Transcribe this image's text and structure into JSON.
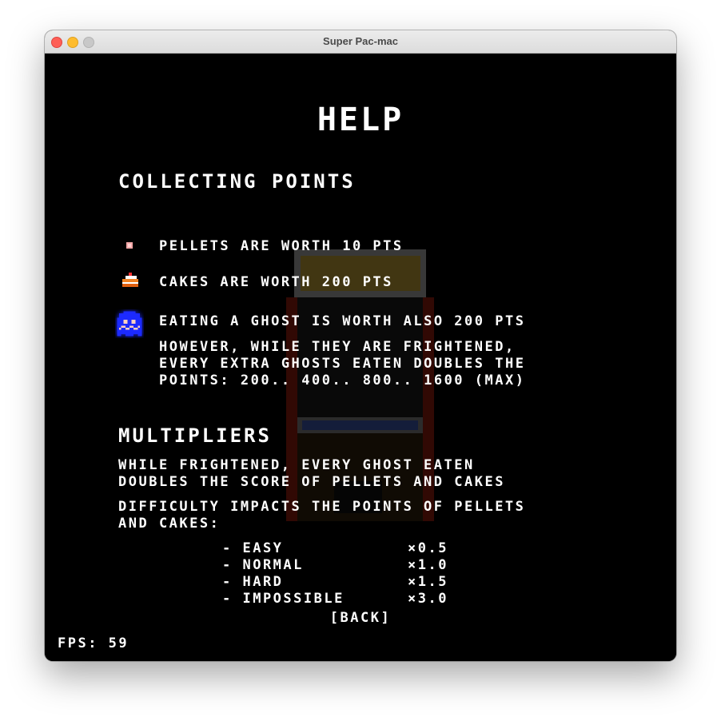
{
  "window": {
    "title": "Super Pac-mac"
  },
  "help": {
    "title": "HELP",
    "collecting": {
      "heading": "COLLECTING POINTS",
      "pellets": "PELLETS ARE WORTH 10 PTS",
      "cakes": "CAKES ARE WORTH 200 PTS",
      "ghost": "EATING A GHOST IS WORTH ALSO 200 PTS",
      "ghost_detail_1": "HOWEVER, WHILE THEY ARE FRIGHTENED,",
      "ghost_detail_2": "EVERY EXTRA GHOSTS EATEN DOUBLES THE",
      "ghost_detail_3": "POINTS: 200.. 400.. 800.. 1600 (MAX)"
    },
    "multipliers": {
      "heading": "MULTIPLIERS",
      "frightened_1": "WHILE FRIGHTENED, EVERY GHOST EATEN",
      "frightened_2": "DOUBLES THE SCORE OF PELLETS AND CAKES",
      "difficulty_1": "DIFFICULTY IMPACTS THE POINTS OF PELLETS",
      "difficulty_2": "AND CAKES:",
      "levels": [
        {
          "name": "- EASY",
          "factor": "×0.5"
        },
        {
          "name": "- NORMAL",
          "factor": "×1.0"
        },
        {
          "name": "- HARD",
          "factor": "×1.5"
        },
        {
          "name": "- IMPOSSIBLE",
          "factor": "×3.0"
        }
      ]
    },
    "back_label": "[BACK]"
  },
  "status": {
    "fps_label": "FPS: 59"
  },
  "icons": {
    "pellet": "pellet-icon",
    "cake": "cake-icon",
    "ghost": "frightened-ghost-icon"
  },
  "colors": {
    "pellet": "#f4a7a7",
    "ghost": "#1f2bff",
    "cake_frosting": "#ffffff",
    "cake_body": "#f08020"
  }
}
